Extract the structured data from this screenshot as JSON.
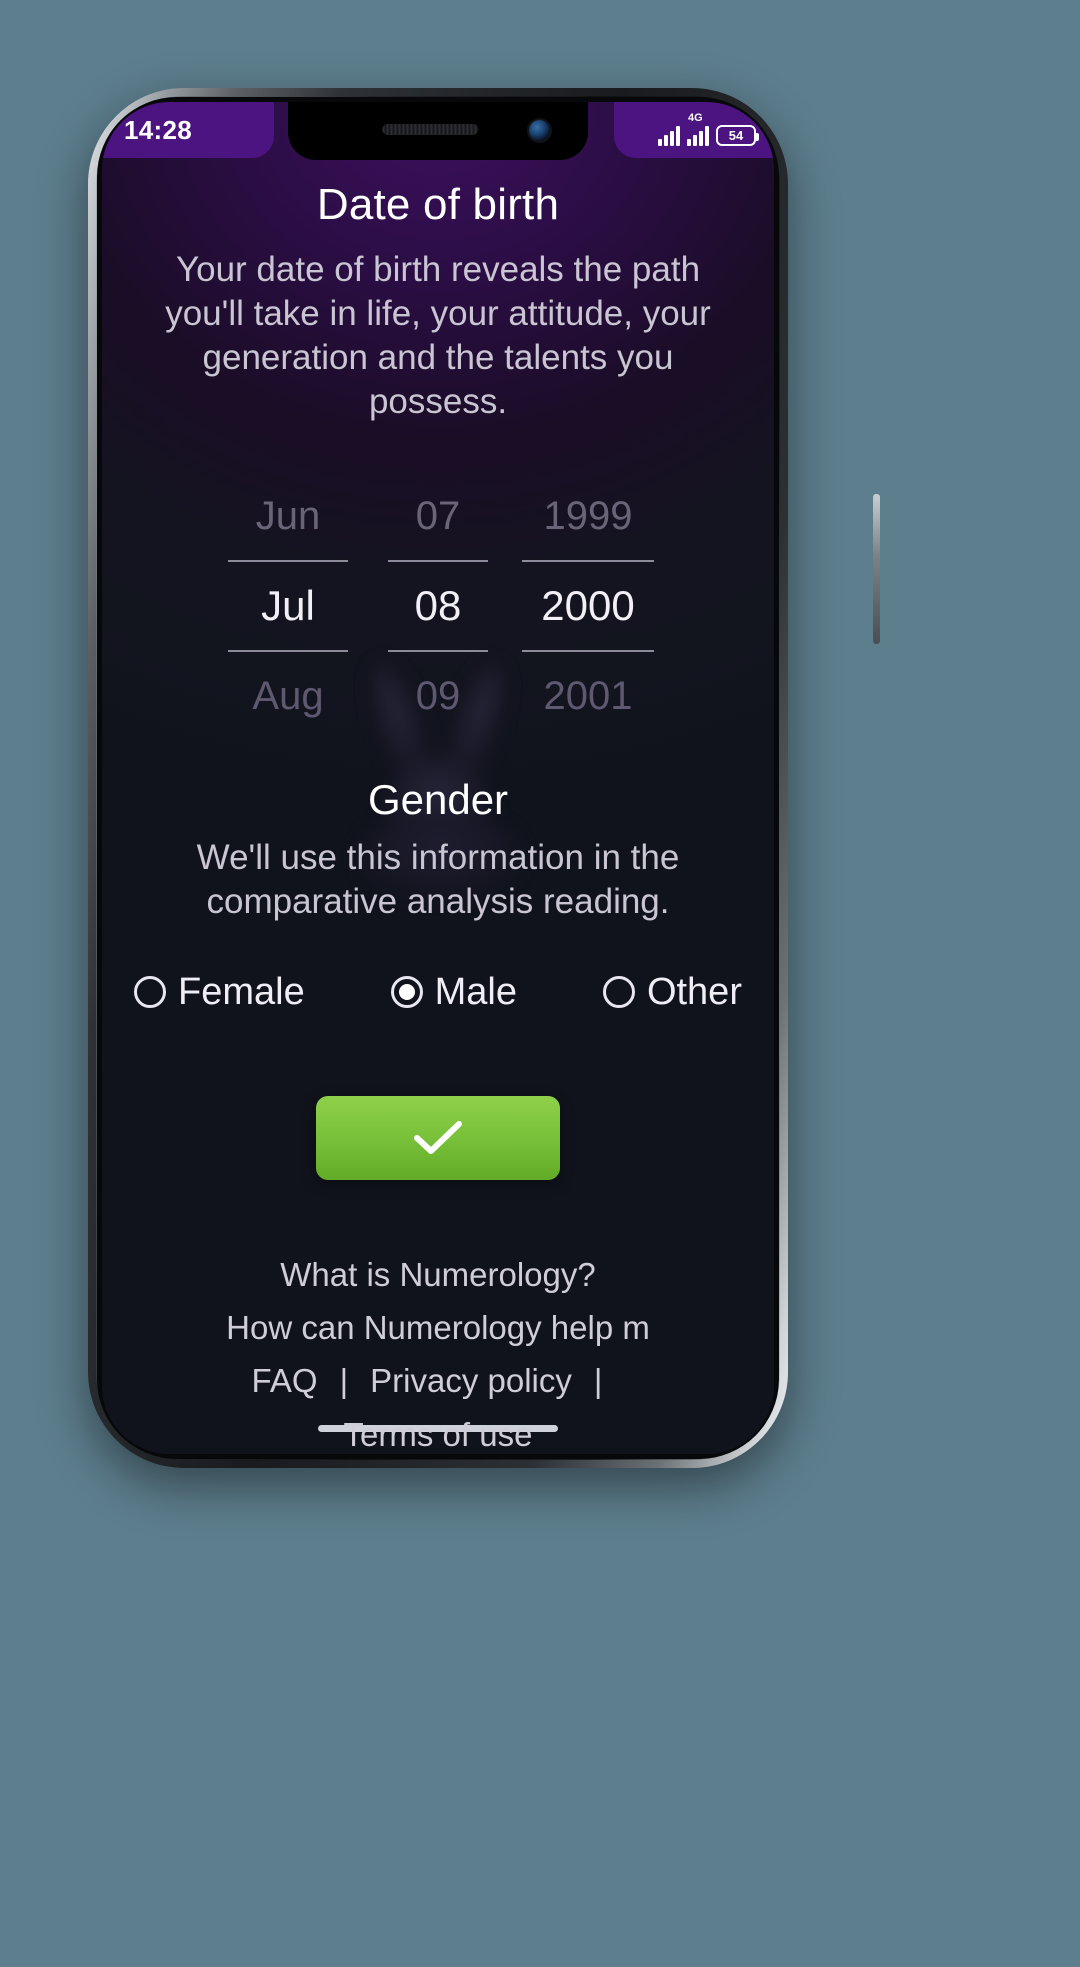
{
  "status_bar": {
    "time": "14:28",
    "network_label": "4G",
    "battery_percent": "54",
    "icons": [
      "signal-bars-icon",
      "signal-bars-icon",
      "battery-icon"
    ]
  },
  "screen": {
    "dob_section": {
      "title": "Date of birth",
      "description": "Your date of birth reveals the path you'll take in life, your attitude, your generation and the talents you possess.",
      "picker": {
        "month": {
          "previous": "Jun",
          "selected": "Jul",
          "next": "Aug"
        },
        "day": {
          "previous": "07",
          "selected": "08",
          "next": "09"
        },
        "year": {
          "previous": "1999",
          "selected": "2000",
          "next": "2001"
        }
      }
    },
    "gender_section": {
      "title": "Gender",
      "description": "We'll use this information in the comparative analysis reading.",
      "options": [
        {
          "label": "Female",
          "selected": false
        },
        {
          "label": "Male",
          "selected": true
        },
        {
          "label": "Other",
          "selected": false
        }
      ]
    },
    "submit_button": {
      "icon": "checkmark-icon",
      "color": "#79c13a"
    },
    "footer": {
      "links": [
        "What is Numerology?",
        "How can Numerology help m"
      ],
      "legal": {
        "faq": "FAQ",
        "separator_1": "|",
        "privacy": "Privacy policy",
        "separator_2": "|",
        "terms": "Terms of use"
      }
    }
  },
  "colors": {
    "status_bar_bg": "#4b1480",
    "accent_green": "#79c13a",
    "text_primary": "#ffffff",
    "text_secondary": "#c9c5d2",
    "picker_dim": "#6a6478"
  }
}
